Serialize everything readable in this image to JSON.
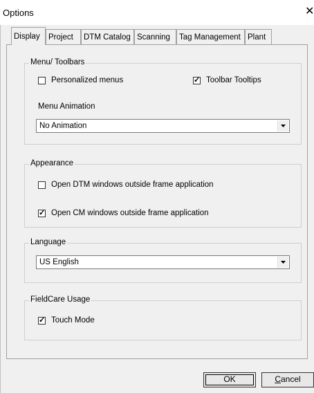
{
  "window": {
    "title": "Options",
    "close_glyph": "✕"
  },
  "tabs": [
    {
      "label": "Display",
      "active": true
    },
    {
      "label": "Project",
      "active": false
    },
    {
      "label": "DTM Catalog",
      "active": false
    },
    {
      "label": "Scanning",
      "active": false
    },
    {
      "label": "Tag Management",
      "active": false
    },
    {
      "label": "Plant",
      "active": false
    }
  ],
  "menu_toolbars": {
    "title": "Menu/ Toolbars",
    "personalized_menus": {
      "label": "Personalized menus",
      "checked": false
    },
    "toolbar_tooltips": {
      "label": "Toolbar Tooltips",
      "checked": true
    },
    "menu_animation_label": "Menu Animation",
    "menu_animation_value": "No Animation"
  },
  "appearance": {
    "title": "Appearance",
    "open_dtm": {
      "label": "Open DTM windows outside frame application",
      "checked": false
    },
    "open_cm": {
      "label": "Open CM windows outside frame application",
      "checked": true
    }
  },
  "language": {
    "title": "Language",
    "value": "US English"
  },
  "fieldcare_usage": {
    "title": "FieldCare Usage",
    "touch_mode": {
      "label": "Touch Mode",
      "checked": true
    }
  },
  "buttons": {
    "ok": "OK",
    "cancel_first": "C",
    "cancel_rest": "ancel"
  },
  "icons": {
    "close": "close-icon",
    "dropdown": "chevron-down-icon",
    "check": "checkmark-icon"
  }
}
